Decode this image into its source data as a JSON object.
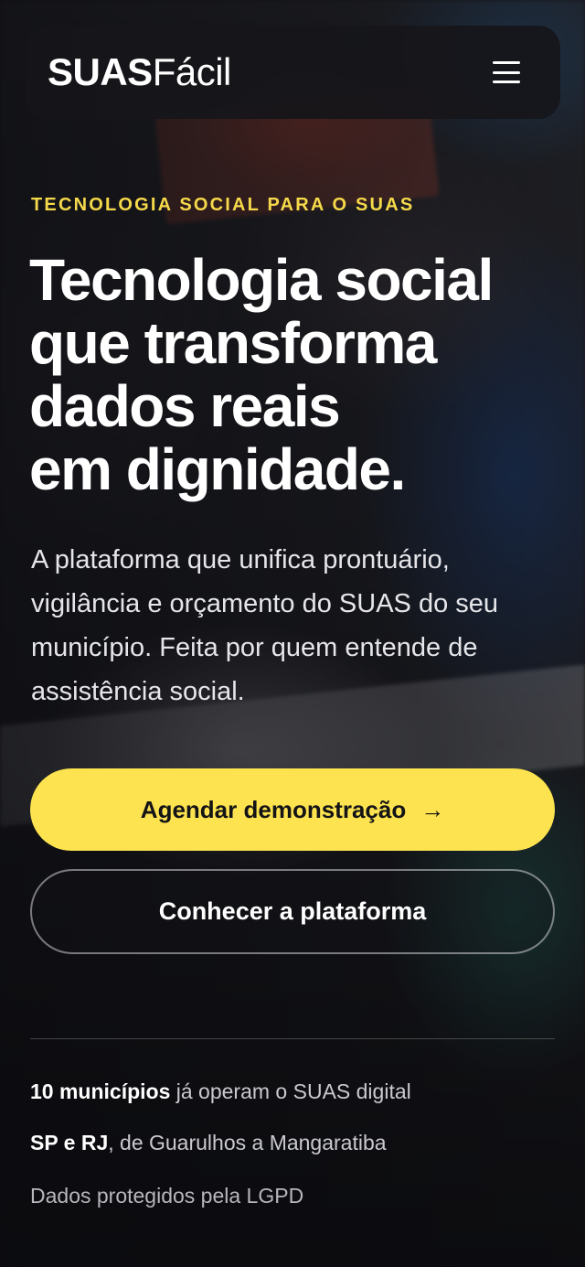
{
  "nav": {
    "logo_bold": "SUAS",
    "logo_light": "Fácil",
    "menu_icon": "hamburger-menu-icon"
  },
  "hero": {
    "eyebrow": "TECNOLOGIA SOCIAL PARA O SUAS",
    "headline_lines": [
      "Tecnologia social",
      "que transforma",
      "dados reais",
      "em dignidade."
    ],
    "lead": "A plataforma que unifica prontuário, vigilância e orçamento do SUAS do seu município. Feita por quem entende de assistência social."
  },
  "cta": {
    "primary_label": "Agendar demonstração",
    "primary_icon": "arrow-right-icon",
    "primary_arrow": "→",
    "secondary_label": "Conhecer a plataforma"
  },
  "facts": [
    {
      "strong": "10 municípios",
      "text": " já operam o SUAS digital"
    },
    {
      "strong": "SP e RJ",
      "text": ", de Guarulhos a Mangaratiba"
    },
    {
      "strong": "",
      "text": "Dados protegidos pela LGPD"
    }
  ],
  "colors": {
    "accent": "#fde34f",
    "eyebrow": "#f6d94a"
  }
}
